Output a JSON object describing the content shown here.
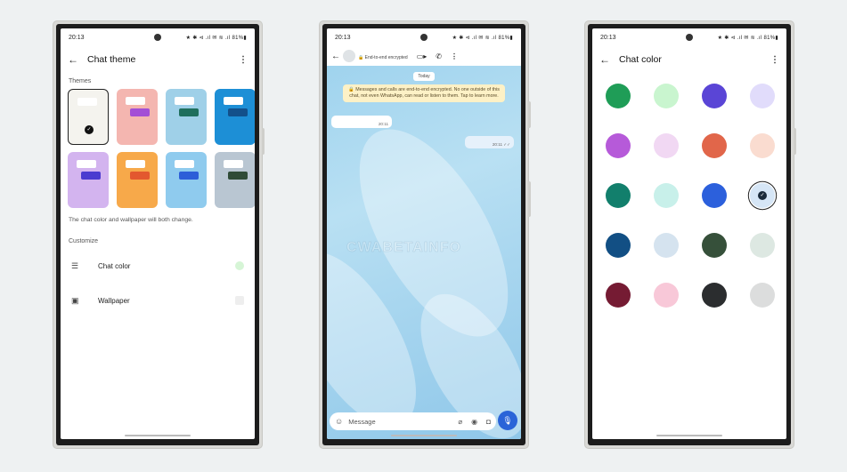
{
  "status_bar": {
    "time": "20:13",
    "icons_text": "★ ✱ ⊲ .ıl ✉ ≋ .ıl 81%▮",
    "battery": "81%"
  },
  "chat_theme_screen": {
    "title": "Chat theme",
    "back_icon": "arrow-left-icon",
    "more_icon": "more-vertical-icon",
    "themes_label": "Themes",
    "themes": [
      {
        "name": "default",
        "background": "#f4f3ee",
        "bubble_color": "#ffffff",
        "selected": true
      },
      {
        "name": "pink-coral",
        "background": "#f4b6b0",
        "bubble_color": "#a34fd6",
        "selected": false
      },
      {
        "name": "beach",
        "background": "#9fd0e8",
        "bubble_color": "#1f6f5d",
        "selected": false
      },
      {
        "name": "blue-lines",
        "background": "#1d8fd6",
        "bubble_color": "#13508a",
        "selected": false
      },
      {
        "name": "lavender",
        "background": "#d3b4ef",
        "bubble_color": "#4b3bd0",
        "selected": false
      },
      {
        "name": "orange",
        "background": "#f7a94a",
        "bubble_color": "#e3582f",
        "selected": false
      },
      {
        "name": "sky",
        "background": "#8fcbee",
        "bubble_color": "#2d5ed8",
        "selected": false
      },
      {
        "name": "botanical",
        "background": "#b9c6d2",
        "bubble_color": "#2f4b37",
        "selected": false
      }
    ],
    "helper_text": "The chat color and wallpaper will both change.",
    "customize_label": "Customize",
    "customize_items": [
      {
        "label": "Chat color",
        "icon": "chat-color-icon",
        "swatch": "#d6f5d6"
      },
      {
        "label": "Wallpaper",
        "icon": "wallpaper-icon",
        "swatch": "#eeeeee"
      }
    ]
  },
  "chat_screen": {
    "back_icon": "arrow-left-icon",
    "encryption_label": "🔒 End-to-end encrypted",
    "actions": [
      "video-call-icon",
      "phone-icon",
      "more-vertical-icon"
    ],
    "date_chip": "Today",
    "encryption_notice": "🔒 Messages and calls are end-to-end encrypted. No one outside of this chat, not even WhatsApp, can read or listen to them. Tap to learn more.",
    "messages": [
      {
        "direction": "incoming",
        "time": "20:11"
      },
      {
        "direction": "outgoing",
        "time": "20:11 ✓✓"
      }
    ],
    "watermark": "CWABETAINFO",
    "composer_placeholder": "Message",
    "composer_icons": [
      "emoji-icon",
      "attach-icon",
      "rupee-payment-icon",
      "camera-icon"
    ],
    "mic_icon": "mic-icon",
    "accent": "#2a64d8"
  },
  "chat_color_screen": {
    "title": "Chat color",
    "back_icon": "arrow-left-icon",
    "more_icon": "more-vertical-icon",
    "colors": [
      {
        "hex": "#1f9d57",
        "selected": false
      },
      {
        "hex": "#c9f5cf",
        "selected": false
      },
      {
        "hex": "#5a45d6",
        "selected": false
      },
      {
        "hex": "#e1dcfb",
        "selected": false
      },
      {
        "hex": "#b65ad9",
        "selected": false
      },
      {
        "hex": "#f1d8f3",
        "selected": false
      },
      {
        "hex": "#e1664a",
        "selected": false
      },
      {
        "hex": "#fadcd0",
        "selected": false
      },
      {
        "hex": "#127f6c",
        "selected": false
      },
      {
        "hex": "#c8f0ea",
        "selected": false
      },
      {
        "hex": "#2c60dc",
        "selected": false
      },
      {
        "hex": "#d6e6f6",
        "selected": true
      },
      {
        "hex": "#124f84",
        "selected": false
      },
      {
        "hex": "#d5e3ef",
        "selected": false
      },
      {
        "hex": "#36503a",
        "selected": false
      },
      {
        "hex": "#dde8e2",
        "selected": false
      },
      {
        "hex": "#751b33",
        "selected": false
      },
      {
        "hex": "#f8c8d8",
        "selected": false
      },
      {
        "hex": "#2b2d2f",
        "selected": false
      },
      {
        "hex": "#dcdddd",
        "selected": false
      }
    ]
  }
}
